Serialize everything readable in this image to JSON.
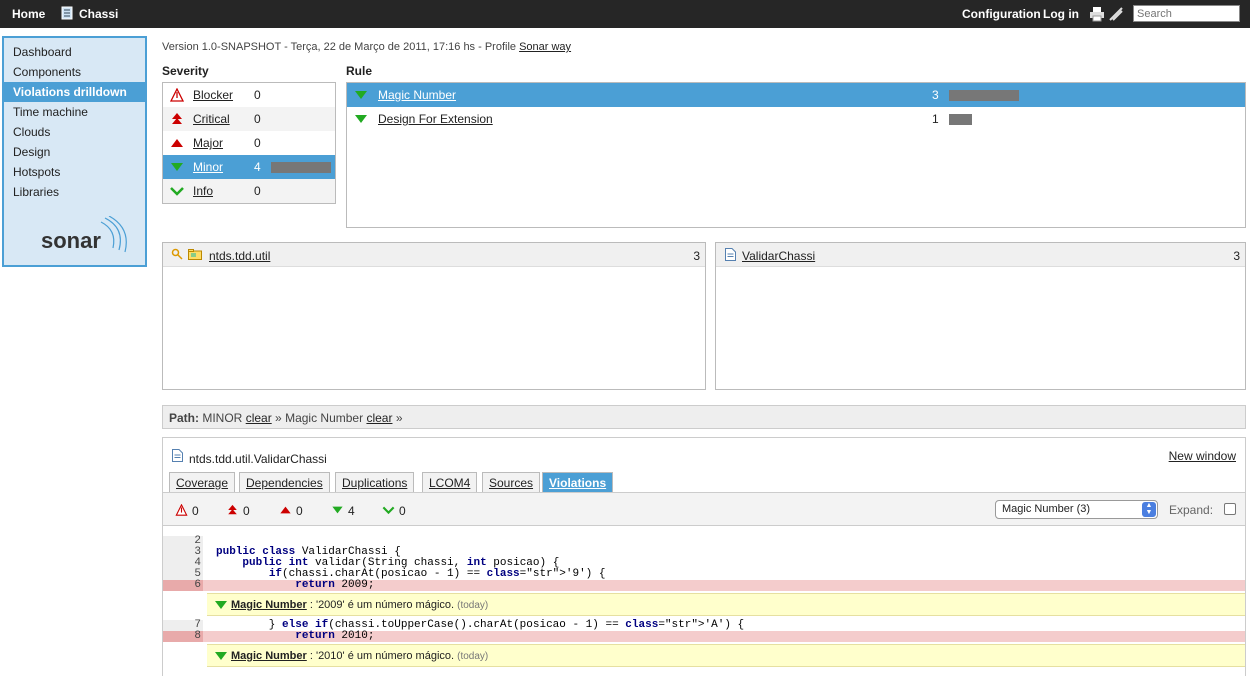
{
  "topbar": {
    "home": "Home",
    "project": "Chassi",
    "configuration": "Configuration",
    "login": "Log in",
    "search_placeholder": "Search"
  },
  "sidebar": {
    "items": [
      {
        "label": "Dashboard"
      },
      {
        "label": "Components"
      },
      {
        "label": "Violations drilldown",
        "selected": true
      },
      {
        "label": "Time machine"
      },
      {
        "label": "Clouds"
      },
      {
        "label": "Design"
      },
      {
        "label": "Hotspots"
      },
      {
        "label": "Libraries"
      }
    ],
    "logo": "sonar"
  },
  "version": {
    "text": "Version 1.0-SNAPSHOT - Terça, 22 de Março de 2011, 17:16 hs - Profile ",
    "profile": "Sonar way"
  },
  "severity": {
    "header": "Severity",
    "rows": [
      {
        "label": "Blocker",
        "count": "0",
        "icon": "blocker-icon"
      },
      {
        "label": "Critical",
        "count": "0",
        "icon": "critical-icon"
      },
      {
        "label": "Major",
        "count": "0",
        "icon": "major-icon"
      },
      {
        "label": "Minor",
        "count": "4",
        "icon": "minor-icon",
        "selected": true,
        "bar_fraction": 1.0
      },
      {
        "label": "Info",
        "count": "0",
        "icon": "info-icon"
      }
    ]
  },
  "rule": {
    "header": "Rule",
    "rows": [
      {
        "label": "Magic Number",
        "count": "3",
        "selected": true,
        "bar_fraction": 1.0
      },
      {
        "label": "Design For Extension",
        "count": "1",
        "bar_fraction": 0.33
      }
    ]
  },
  "packages": {
    "name": "ntds.tdd.util",
    "count": "3"
  },
  "files": {
    "name": "ValidarChassi",
    "count": "3"
  },
  "path": {
    "label": "Path:",
    "p1": "MINOR",
    "clear": "clear",
    "sep": "»",
    "p2": "Magic Number"
  },
  "source": {
    "filename": "ntds.tdd.util.ValidarChassi",
    "new_window": "New window",
    "tabs": [
      "Coverage",
      "Dependencies",
      "Duplications",
      "LCOM4",
      "Sources",
      "Violations"
    ],
    "active_tab": "Violations",
    "counters": [
      "0",
      "0",
      "0",
      "4",
      "0"
    ],
    "rule_select": "Magic Number (3)",
    "expand": "Expand:",
    "lines": [
      {
        "n": "2",
        "code": ""
      },
      {
        "n": "3",
        "code": "public class ValidarChassi {"
      },
      {
        "n": "4",
        "code": "    public int validar(String chassi, int posicao) {"
      },
      {
        "n": "5",
        "code": "        if(chassi.charAt(posicao - 1) == '9') {"
      },
      {
        "n": "6",
        "code": "            return 2009;"
      },
      {
        "n": "7",
        "code": "        } else if(chassi.toUpperCase().charAt(posicao - 1) == 'A') {"
      },
      {
        "n": "8",
        "code": "            return 2010;"
      }
    ],
    "violations": [
      {
        "rule": "Magic Number",
        "message": " : '2009' é um número mágico. ",
        "when": "(today)"
      },
      {
        "rule": "Magic Number",
        "message": " : '2010' é um número mágico. ",
        "when": "(today)"
      }
    ]
  },
  "colors": {
    "accent": "#4b9fd5",
    "topbar": "#262626",
    "violation_bg": "#ffffcc",
    "hit_line": "#f4cccc"
  }
}
